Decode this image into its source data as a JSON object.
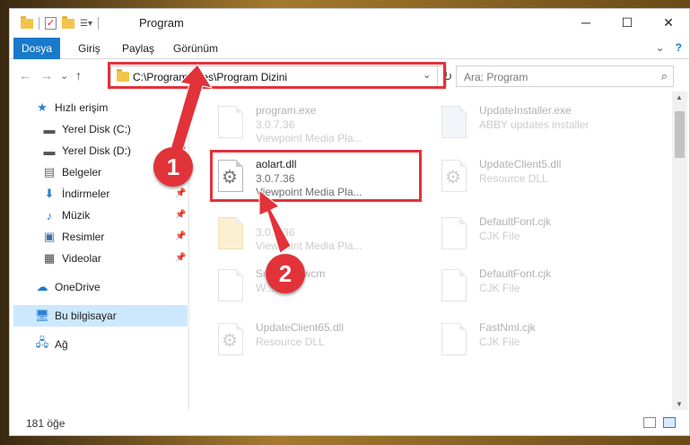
{
  "window": {
    "title": "Program",
    "minimize": "─",
    "maximize": "☐",
    "close": "✕"
  },
  "ribbon": {
    "file_tab": "Dosya",
    "tabs": [
      "Giriş",
      "Paylaş",
      "Görünüm"
    ],
    "expand": "⌄",
    "help": "?"
  },
  "nav": {
    "back": "←",
    "forward": "→",
    "recent": "⌄",
    "up": "↑"
  },
  "address": {
    "path": "C:\\Program Files\\Program Dizini",
    "dropdown": "⌄",
    "refresh": "↻"
  },
  "search": {
    "placeholder": "Ara: Program",
    "icon": "search-icon"
  },
  "sidebar": {
    "items": [
      {
        "label": "Hızlı erişim",
        "icon": "star-icon",
        "pinned": false
      },
      {
        "label": "Yerel Disk (C:)",
        "icon": "drive-icon",
        "pinned": true
      },
      {
        "label": "Yerel Disk (D:)",
        "icon": "drive-icon",
        "pinned": true
      },
      {
        "label": "Belgeler",
        "icon": "documents-icon",
        "pinned": true
      },
      {
        "label": "İndirmeler",
        "icon": "download-icon",
        "pinned": true
      },
      {
        "label": "Müzik",
        "icon": "music-icon",
        "pinned": true
      },
      {
        "label": "Resimler",
        "icon": "pictures-icon",
        "pinned": true
      },
      {
        "label": "Videolar",
        "icon": "video-icon",
        "pinned": true
      },
      {
        "label": "OneDrive",
        "icon": "cloud-icon",
        "pinned": false
      },
      {
        "label": "Bu bilgisayar",
        "icon": "computer-icon",
        "pinned": false,
        "selected": true
      },
      {
        "label": "Ağ",
        "icon": "network-icon",
        "pinned": false
      }
    ]
  },
  "files": [
    {
      "name": "program.exe",
      "line2": "3.0.7.36",
      "line3": "Viewpoint Media Pla...",
      "faded": true
    },
    {
      "name": "UpdateInstaller.exe",
      "line2": "ABBY updates installer",
      "line3": "",
      "faded": true
    },
    {
      "name": "aolart.dll",
      "line2": "3.0.7.36",
      "line3": "Viewpoint Media Pla...",
      "faded": false
    },
    {
      "name": "UpdateClient5.dll",
      "line2": "Resource DLL",
      "line3": "",
      "faded": true
    },
    {
      "name": "",
      "line2": "3.0.7.36",
      "line3": "Viewpoint Media Pla...",
      "faded": true
    },
    {
      "name": "DefaultFont.cjk",
      "line2": "CJK File",
      "line3": "",
      "faded": true
    },
    {
      "name": "Sm...P14.wcm",
      "line2": "W...",
      "line3": "",
      "faded": true
    },
    {
      "name": "DefaultFont.cjk",
      "line2": "CJK File",
      "line3": "",
      "faded": true
    },
    {
      "name": "UpdateClient65.dll",
      "line2": "Resource DLL",
      "line3": "",
      "faded": true
    },
    {
      "name": "FastNml.cjk",
      "line2": "CJK File",
      "line3": "",
      "faded": true
    }
  ],
  "status": {
    "count": "181 öğe"
  },
  "annotations": {
    "step1": "1",
    "step2": "2",
    "color": "#e2323a"
  }
}
